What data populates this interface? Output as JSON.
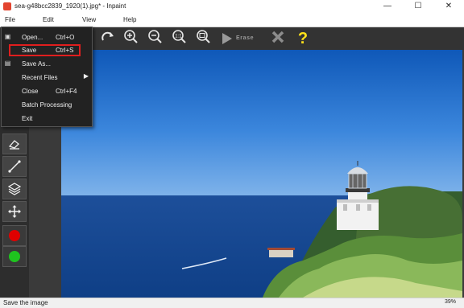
{
  "window": {
    "title": "sea-g48bcc2839_1920(1).jpg* - Inpaint",
    "controls": {
      "minimize": "—",
      "maximize": "☐",
      "close": "✕"
    }
  },
  "menubar": {
    "file": "File",
    "edit": "Edit",
    "view": "View",
    "help": "Help"
  },
  "toolbar": {
    "erase_label": "Erase",
    "icons": [
      "redo-icon",
      "zoom-in-icon",
      "zoom-out-icon",
      "actual-size-icon",
      "fit-window-icon",
      "erase-run-icon",
      "cancel-icon",
      "help-icon"
    ]
  },
  "file_menu": {
    "items": [
      {
        "label": "Open...",
        "shortcut": "Ctrl+O",
        "icon": "open-folder-icon"
      },
      {
        "label": "Save",
        "shortcut": "Ctrl+S",
        "highlighted": true
      },
      {
        "label": "Save As...",
        "shortcut": "",
        "icon": "save-disk-icon"
      },
      {
        "label": "Recent Files",
        "shortcut": "",
        "submenu": true
      },
      {
        "label": "Close",
        "shortcut": "Ctrl+F4"
      },
      {
        "label": "Batch Processing",
        "shortcut": ""
      },
      {
        "label": "Exit",
        "shortcut": ""
      }
    ]
  },
  "left_tools": {
    "items": [
      "eraser-icon",
      "line-tool-icon",
      "layers-icon",
      "move-icon",
      "red-color-swatch",
      "green-color-swatch"
    ],
    "colors": {
      "red": "#e00000",
      "green": "#1fc41f"
    }
  },
  "status": {
    "message": "Save the image",
    "zoom": "39%"
  },
  "colors": {
    "highlight_border": "#e01e1e",
    "toolbar_bg": "#333333",
    "menu_bg": "#222222"
  }
}
